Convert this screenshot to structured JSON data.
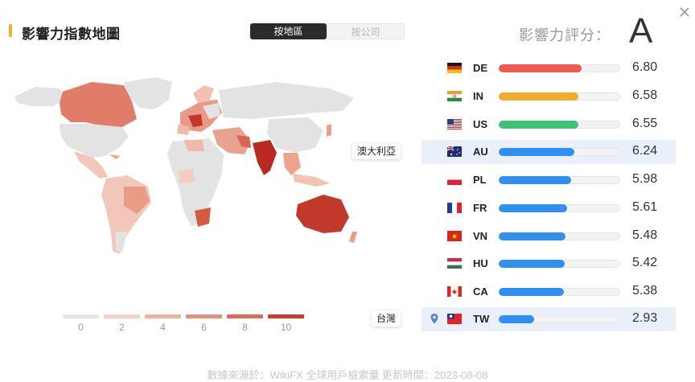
{
  "header": {
    "title": "影響力指數地圖",
    "tabs": [
      {
        "label": "按地區",
        "active": true
      },
      {
        "label": "按公司",
        "active": false
      }
    ],
    "score_label": "影響力評分：",
    "grade": "A"
  },
  "map": {
    "tags": [
      "澳大利亞",
      "台灣"
    ],
    "legend": [
      {
        "label": "0",
        "color": "#e6e6e6"
      },
      {
        "label": "2",
        "color": "#f3d2c8"
      },
      {
        "label": "4",
        "color": "#eeb19f"
      },
      {
        "label": "6",
        "color": "#e6907a"
      },
      {
        "label": "8",
        "color": "#dc6d55"
      },
      {
        "label": "10",
        "color": "#c93a30"
      }
    ]
  },
  "ranking": [
    {
      "code": "DE",
      "flag": "flag-germany-icon",
      "value": "6.80",
      "score": 6.8,
      "bar_color": "#ef5a50"
    },
    {
      "code": "IN",
      "flag": "flag-india-icon",
      "value": "6.58",
      "score": 6.58,
      "bar_color": "#f0ad2c"
    },
    {
      "code": "US",
      "flag": "flag-usa-icon",
      "value": "6.55",
      "score": 6.55,
      "bar_color": "#3ec372"
    },
    {
      "code": "AU",
      "flag": "flag-australia-icon",
      "value": "6.24",
      "score": 6.24,
      "bar_color": "#2f8ff2",
      "highlight": true
    },
    {
      "code": "PL",
      "flag": "flag-poland-icon",
      "value": "5.98",
      "score": 5.98,
      "bar_color": "#2f8ff2"
    },
    {
      "code": "FR",
      "flag": "flag-france-icon",
      "value": "5.61",
      "score": 5.61,
      "bar_color": "#2f8ff2"
    },
    {
      "code": "VN",
      "flag": "flag-vietnam-icon",
      "value": "5.48",
      "score": 5.48,
      "bar_color": "#2f8ff2"
    },
    {
      "code": "HU",
      "flag": "flag-hungary-icon",
      "value": "5.42",
      "score": 5.42,
      "bar_color": "#2f8ff2"
    },
    {
      "code": "CA",
      "flag": "flag-canada-icon",
      "value": "5.38",
      "score": 5.38,
      "bar_color": "#2f8ff2"
    },
    {
      "code": "TW",
      "flag": "flag-taiwan-icon",
      "value": "2.93",
      "score": 2.93,
      "bar_color": "#2f8ff2",
      "highlight": true,
      "pinned": true
    }
  ],
  "footer": "數據來源於：WikiFX 全球用戶檢索量 更新時間：2023-08-08"
}
